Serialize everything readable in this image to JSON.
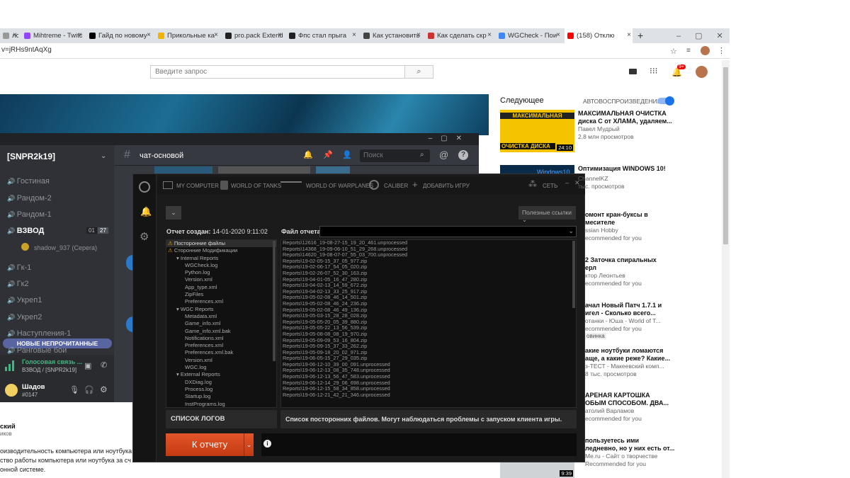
{
  "browser": {
    "tabs": [
      {
        "label": "лс",
        "color": "#999"
      },
      {
        "label": "Mihtreme - Twitc",
        "color": "#9146ff"
      },
      {
        "label": "Гайд по новому",
        "color": "#000"
      },
      {
        "label": "Прикольные ка",
        "color": "#f0b400"
      },
      {
        "label": "pro.pack Extend",
        "color": "#222"
      },
      {
        "label": "Фпс стал прыга",
        "color": "#222"
      },
      {
        "label": "Как установить",
        "color": "#444"
      },
      {
        "label": "Как сделать скр",
        "color": "#c33"
      },
      {
        "label": "WGCheck - Пои",
        "color": "#4285f4"
      },
      {
        "label": "(158) Отклю",
        "color": "#ff0000"
      }
    ],
    "new_tab": "+",
    "url": "v=jRHs9ntAqXg"
  },
  "youtube": {
    "search_placeholder": "Введите запрос",
    "notif_count": "9+",
    "next_label": "Следующее",
    "autoplay_label": "АВТОВОСПРОИЗВЕДЕНИЕ",
    "recs": [
      {
        "title1": "МАКСИМАЛЬНАЯ ОЧИСТКА",
        "title2": "диска С от ХЛАМА, удаляем...",
        "channel": "Павел Мудрый",
        "views": "2,8 млн просмотров",
        "duration": "24:10",
        "thumb_top": "МАКСИМАЛЬНАЯ",
        "thumb_bottom": "ОЧИСТКА ДИСКА"
      },
      {
        "title1": "Оптимизация WINDOWS 10!",
        "title2": "",
        "channel": "ChannelKZ",
        "views": "тыс. просмотров",
        "thumb_text": "Windows10"
      },
      {
        "title1": "омонт кран-буксы в",
        "title2": "месителе",
        "channel": "ssian Hobby",
        "views": "ecommended for you"
      },
      {
        "title1": "2 Заточка спиральных",
        "title2": "ерл",
        "channel": "ктор Леонтьев",
        "views": "ecommended for you"
      },
      {
        "title1": "ачал Новый Патч 1.7.1 и",
        "title2": "игел - Сколько всего...",
        "channel": "отанки - Юша - World of T...",
        "views": "ecommended for you",
        "badge": "овинка"
      },
      {
        "title1": "акие ноутбуки ломаются",
        "title2": "аще, а какие реже? Какие...",
        "channel": "з-ТЕСТ - Макеевский комп...",
        "views": "8 тыс. просмотров"
      },
      {
        "title1": "АРЕНАЯ КАРТОШКА",
        "title2": "ОБЫМ СПОСОБОМ. ДВА...",
        "channel": "атолий Варламов",
        "views": "ecommended for you"
      },
      {
        "title1": "пользуетесь ими",
        "title2": "ледневно, но у них есть от...",
        "channel": "Me.ru - Сайт о творчестве",
        "views": "Recommended for you",
        "duration": "9:39"
      }
    ],
    "desc_author": "ский",
    "desc_sub": "иков",
    "desc_lines": [
      "оизводительность компьютера или ноутбука",
      "ство работы  компьютера или ноутбука за сч",
      "онной системе."
    ]
  },
  "discord": {
    "server": "[SNPR2k19]",
    "chat_channel": "чат-основой",
    "search_placeholder": "Поиск",
    "channels": [
      {
        "name": "Гостиная"
      },
      {
        "name": "Рандом-2"
      },
      {
        "name": "Рандом-1"
      },
      {
        "name": "ВЗВОД",
        "active": true,
        "n1": "01",
        "n2": "27"
      },
      {
        "name": "Гк-1"
      },
      {
        "name": "Гк2"
      },
      {
        "name": "Укреп1"
      },
      {
        "name": "Укреп2"
      },
      {
        "name": "Наступления-1"
      },
      {
        "name": "Ранговые бои"
      }
    ],
    "member": "shadow_937 (Cepera)",
    "new_unread": "НОВЫЕ НЕПРОЧИТАННЫЕ",
    "voice_status": "Голосовая связь ...",
    "voice_channel": "ВЗВОД / [SNPR2k19]",
    "username": "Шадов",
    "tag": "#0147"
  },
  "wgcheck": {
    "nav": [
      "MY COMPUTER",
      "WORLD OF TANKS",
      "WORLD OF WARPLANES",
      "CALIBER",
      "ДОБАВИТЬ ИГРУ",
      "СЕТЬ"
    ],
    "quick_links": "Полезные ссылки",
    "created_label": "Отчет создан:",
    "created_value": "14-01-2020 9:11:02",
    "file_label": "Файл отчета:",
    "tree": [
      {
        "t": "Посторонние файлы",
        "warn": true,
        "sel": true,
        "lvl": 0
      },
      {
        "t": "Сторонние Модификации",
        "warn": true,
        "lvl": 0
      },
      {
        "t": "Internal Reports",
        "lvl": 1,
        "exp": true
      },
      {
        "t": "WGCheck.log",
        "lvl": 2
      },
      {
        "t": "Python.log",
        "lvl": 2
      },
      {
        "t": "Version.xml",
        "lvl": 2
      },
      {
        "t": "App_type.xml",
        "lvl": 2
      },
      {
        "t": "ZipFiles",
        "lvl": 2
      },
      {
        "t": "Preferences.xml",
        "lvl": 2
      },
      {
        "t": "WGC Reports",
        "lvl": 1,
        "exp": true
      },
      {
        "t": "Metadata.xml",
        "lvl": 2
      },
      {
        "t": "Game_info.xml",
        "lvl": 2
      },
      {
        "t": "Game_info.xml.bak",
        "lvl": 2
      },
      {
        "t": "Notifications.xml",
        "lvl": 2
      },
      {
        "t": "Preferences.xml",
        "lvl": 2
      },
      {
        "t": "Preferences.xml.bak",
        "lvl": 2
      },
      {
        "t": "Version.xml",
        "lvl": 2
      },
      {
        "t": "WGC.log",
        "lvl": 2
      },
      {
        "t": "External Reports",
        "lvl": 1,
        "exp": true
      },
      {
        "t": "DXDiag.log",
        "lvl": 2
      },
      {
        "t": "Process.log",
        "lvl": 2
      },
      {
        "t": "Startup.log",
        "lvl": 2
      },
      {
        "t": "InstPrograms.log",
        "lvl": 2
      }
    ],
    "files": [
      "Reports\\12616_19-08-27-15_19_20_461.unprocessed",
      "Reports\\14368_19-09-06-10_51_29_268.unprocessed",
      "Reports\\14620_19-08-07-07_55_03_700.unprocessed",
      "Reports\\19-02-05-15_37_05_977.zip",
      "Reports\\19-02-06-17_54_05_020.zip",
      "Reports\\19-02-26-07_52_30_163.zip",
      "Reports\\19-04-01-05_16_47_280.zip",
      "Reports\\19-04-02-13_14_59_672.zip",
      "Reports\\19-04-02-13_33_25_917.zip",
      "Reports\\19-05-02-08_46_14_501.zip",
      "Reports\\19-05-02-08_46_24_236.zip",
      "Reports\\19-05-02-08_46_49_136.zip",
      "Reports\\19-05-03-15_28_28_028.zip",
      "Reports\\19-05-05-20_05_39_880.zip",
      "Reports\\19-05-05-22_13_56_539.zip",
      "Reports\\19-05-08-08_08_19_970.zip",
      "Reports\\19-05-09-09_53_16_804.zip",
      "Reports\\19-05-09-15_37_33_262.zip",
      "Reports\\19-05-09-18_20_02_971.zip",
      "Reports\\19-06-05-15_27_29_035.zip",
      "Reports\\19-06-12-10_39_00_091.unprocessed",
      "Reports\\19-06-12-13_08_35_748.unprocessed",
      "Reports\\19-06-12-13_56_47_583.unprocessed",
      "Reports\\19-06-12-14_29_06_698.unprocessed",
      "Reports\\19-06-12-15_58_34_858.unprocessed",
      "Reports\\19-06-12-21_42_21_346.unprocessed"
    ],
    "section_title": "СПИСОК ЛОГОВ",
    "section_desc": "Список посторонних файлов. Могут наблюдаться проблемы с запуском клиента игры.",
    "report_button": "К отчету",
    "info_icon": "ℹ"
  }
}
